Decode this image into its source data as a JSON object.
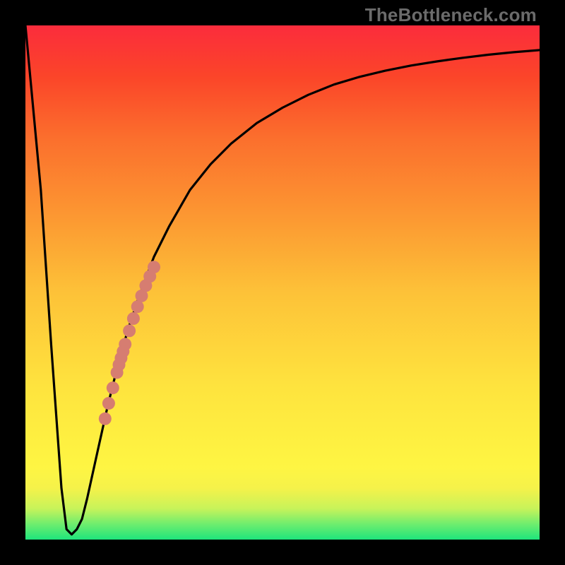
{
  "watermark": "TheBottleneck.com",
  "colors": {
    "frame": "#000000",
    "curve": "#000000",
    "dots": "#d67d71",
    "gradient_top": "#fb2c3c",
    "gradient_bottom": "#1ee57c"
  },
  "chart_data": {
    "type": "line",
    "title": "",
    "xlabel": "",
    "ylabel": "",
    "xlim": [
      0,
      100
    ],
    "ylim": [
      0,
      100
    ],
    "grid": false,
    "series": [
      {
        "name": "bottleneck-curve",
        "x": [
          0,
          3,
          5,
          7,
          8,
          9,
          10,
          11,
          12,
          14,
          16,
          18,
          20,
          22,
          25,
          28,
          32,
          36,
          40,
          45,
          50,
          55,
          60,
          65,
          70,
          75,
          80,
          85,
          90,
          95,
          100
        ],
        "values": [
          100,
          68,
          38,
          10,
          2,
          1,
          2,
          4,
          8,
          17,
          26,
          34,
          41,
          47,
          55,
          61,
          68,
          73,
          77,
          81,
          84,
          86.5,
          88.5,
          90,
          91.2,
          92.2,
          93,
          93.7,
          94.3,
          94.8,
          95.2
        ]
      }
    ],
    "markers": {
      "name": "highlight-dots",
      "x": [
        15.5,
        16.2,
        17.0,
        17.8,
        18.6,
        19.4,
        20.2,
        21.0,
        21.8,
        22.6,
        23.4,
        24.2,
        25.0,
        19.0,
        18.2
      ],
      "values": [
        23.5,
        26.5,
        29.5,
        32.5,
        35.3,
        38.0,
        40.6,
        43.0,
        45.3,
        47.4,
        49.4,
        51.2,
        53.0,
        36.6,
        34.0
      ]
    }
  }
}
